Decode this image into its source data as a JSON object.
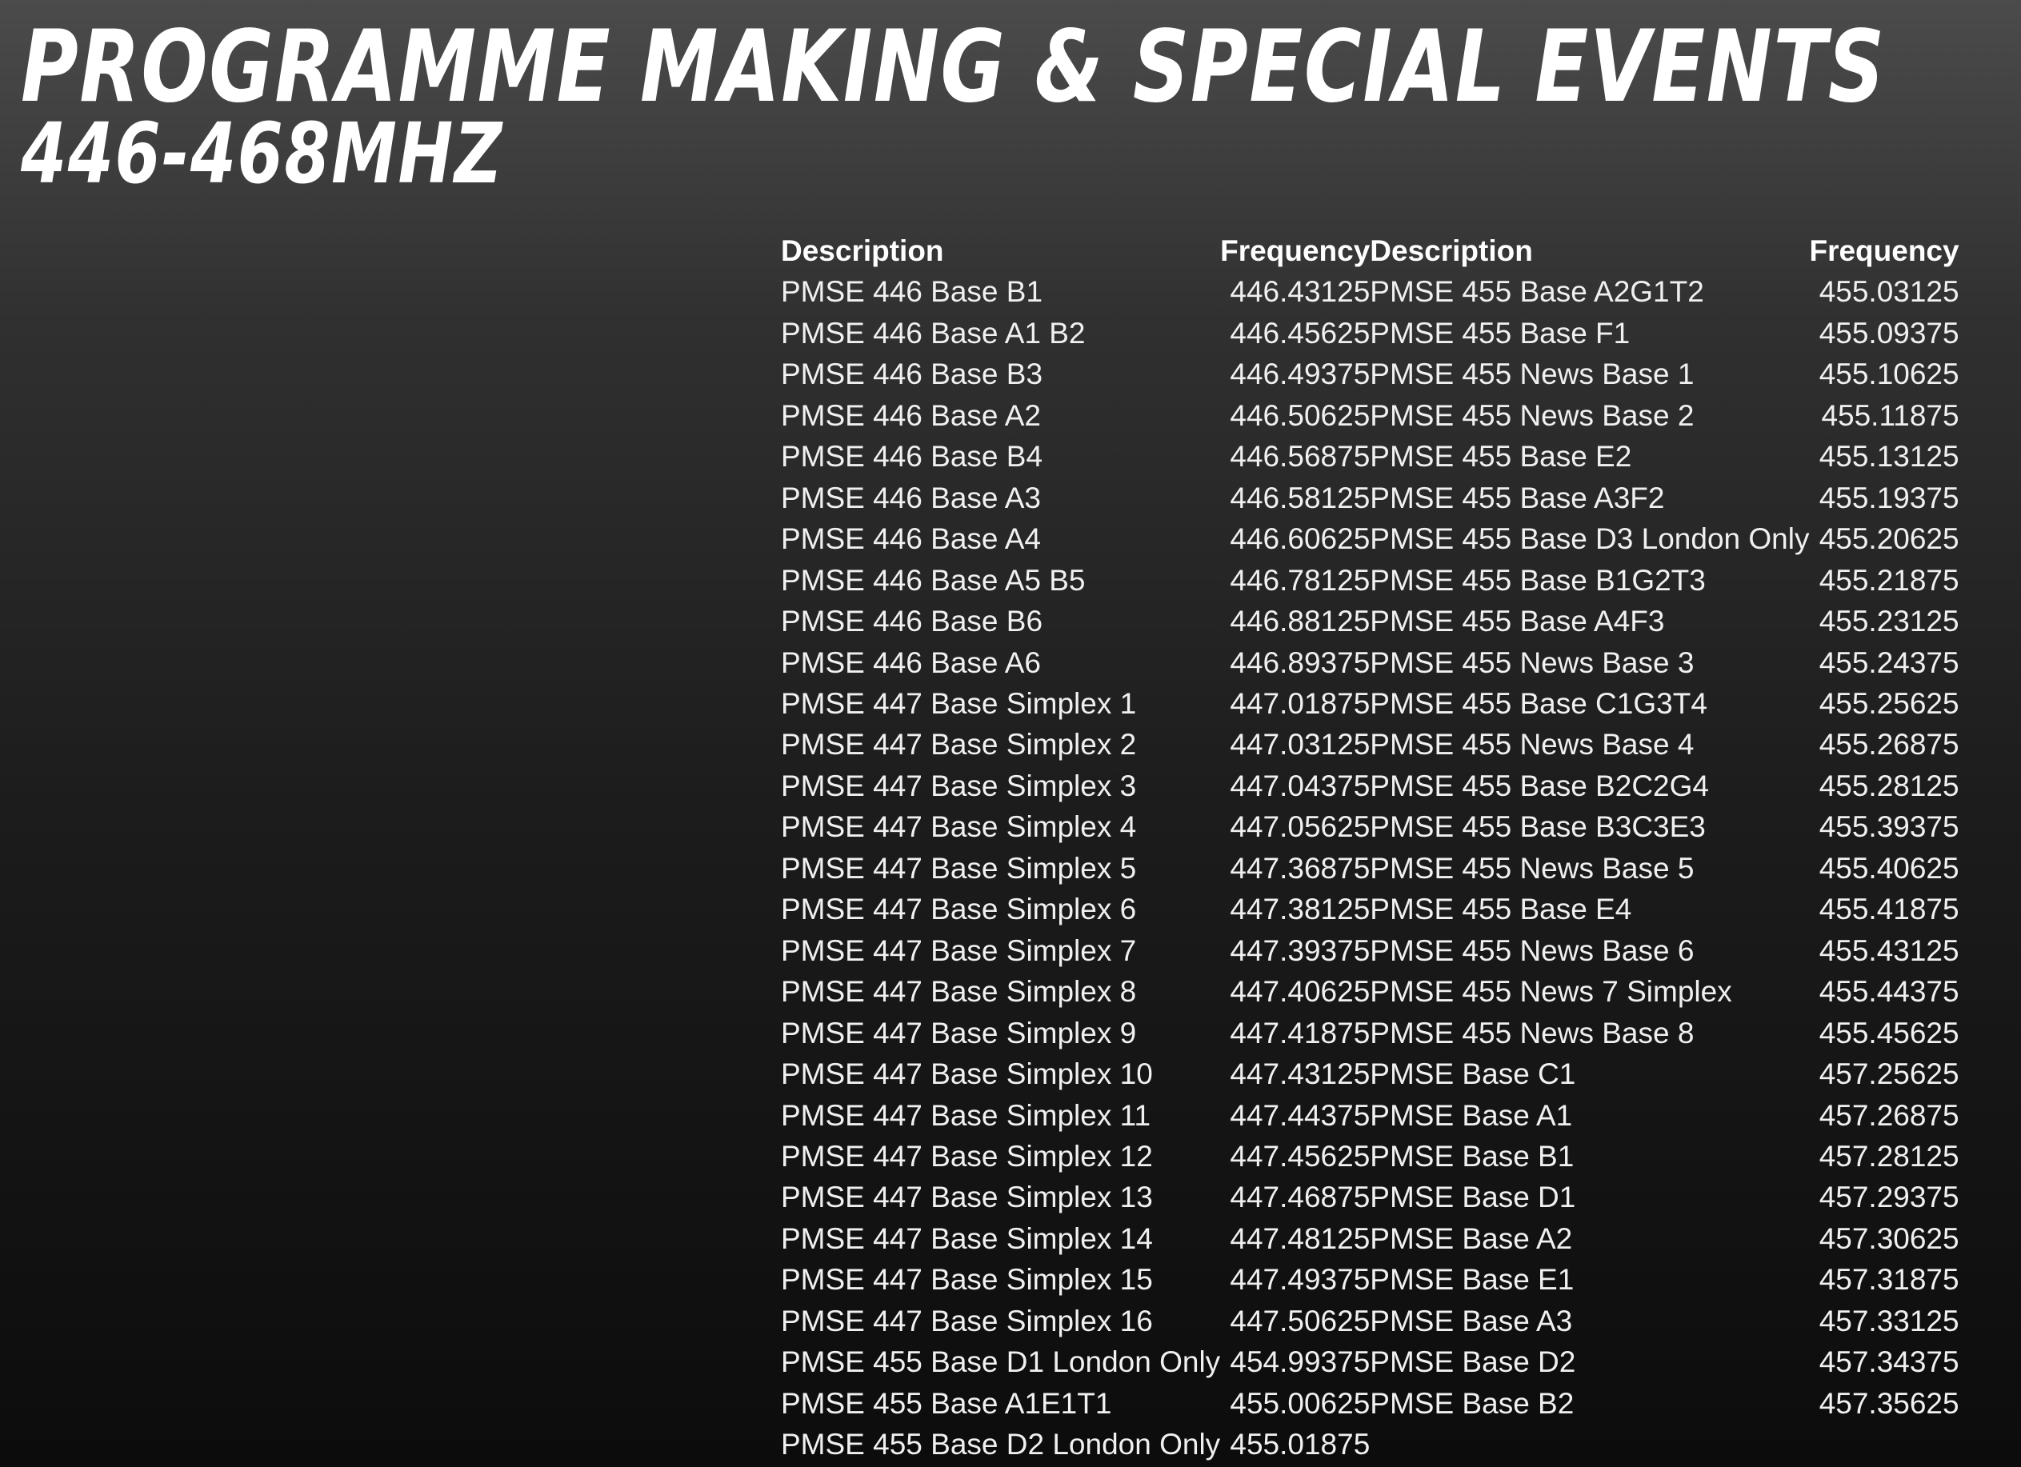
{
  "title": "PROGRAMME MAKING & SPECIAL EVENTS",
  "subtitle": "446-468MHZ",
  "table": {
    "headers": [
      "Description",
      "Frequency",
      "Description",
      "Frequency"
    ],
    "rows": [
      [
        "PMSE 446 Base B1",
        "446.43125",
        "PMSE 455 Base A2G1T2",
        "455.03125"
      ],
      [
        "PMSE 446 Base A1 B2",
        "446.45625",
        "PMSE 455 Base F1",
        "455.09375"
      ],
      [
        "PMSE 446 Base B3",
        "446.49375",
        "PMSE 455 News Base 1",
        "455.10625"
      ],
      [
        "PMSE 446 Base A2",
        "446.50625",
        "PMSE 455 News Base 2",
        "455.11875"
      ],
      [
        "PMSE 446 Base B4",
        "446.56875",
        "PMSE 455 Base E2",
        "455.13125"
      ],
      [
        "PMSE 446 Base A3",
        "446.58125",
        "PMSE 455 Base A3F2",
        "455.19375"
      ],
      [
        "PMSE 446 Base A4",
        "446.60625",
        "PMSE 455 Base D3 London Only",
        "455.20625"
      ],
      [
        "PMSE 446 Base A5 B5",
        "446.78125",
        "PMSE 455 Base B1G2T3",
        "455.21875"
      ],
      [
        "PMSE 446 Base B6",
        "446.88125",
        "PMSE 455 Base A4F3",
        "455.23125"
      ],
      [
        "PMSE 446 Base A6",
        "446.89375",
        "PMSE 455 News Base 3",
        "455.24375"
      ],
      [
        "PMSE 447 Base Simplex 1",
        "447.01875",
        "PMSE 455 Base C1G3T4",
        "455.25625"
      ],
      [
        "PMSE 447 Base Simplex 2",
        "447.03125",
        "PMSE 455 News Base 4",
        "455.26875"
      ],
      [
        "PMSE 447 Base Simplex 3",
        "447.04375",
        "PMSE 455 Base B2C2G4",
        "455.28125"
      ],
      [
        "PMSE 447 Base Simplex 4",
        "447.05625",
        "PMSE 455 Base B3C3E3",
        "455.39375"
      ],
      [
        "PMSE 447 Base Simplex 5",
        "447.36875",
        "PMSE 455 News Base 5",
        "455.40625"
      ],
      [
        "PMSE 447 Base Simplex 6",
        "447.38125",
        "PMSE 455 Base E4",
        "455.41875"
      ],
      [
        "PMSE 447 Base Simplex 7",
        "447.39375",
        "PMSE 455 News Base 6",
        "455.43125"
      ],
      [
        "PMSE 447 Base Simplex 8",
        "447.40625",
        "PMSE 455 News 7 Simplex",
        "455.44375"
      ],
      [
        "PMSE 447 Base Simplex 9",
        "447.41875",
        "PMSE 455 News Base 8",
        "455.45625"
      ],
      [
        "PMSE 447 Base Simplex 10",
        "447.43125",
        "PMSE Base C1",
        "457.25625"
      ],
      [
        "PMSE 447 Base Simplex 11",
        "447.44375",
        "PMSE Base A1",
        "457.26875"
      ],
      [
        "PMSE 447 Base Simplex 12",
        "447.45625",
        "PMSE Base B1",
        "457.28125"
      ],
      [
        "PMSE 447 Base Simplex 13",
        "447.46875",
        "PMSE Base D1",
        "457.29375"
      ],
      [
        "PMSE 447 Base Simplex 14",
        "447.48125",
        "PMSE Base A2",
        "457.30625"
      ],
      [
        "PMSE 447 Base Simplex 15",
        "447.49375",
        "PMSE Base E1",
        "457.31875"
      ],
      [
        "PMSE 447 Base Simplex 16",
        "447.50625",
        "PMSE Base A3",
        "457.33125"
      ],
      [
        "PMSE 455 Base D1 London Only",
        "454.99375",
        "PMSE Base D2",
        "457.34375"
      ],
      [
        "PMSE 455 Base A1E1T1",
        "455.00625",
        "PMSE Base B2",
        "457.35625"
      ],
      [
        "PMSE 455 Base D2 London Only",
        "455.01875",
        "",
        ""
      ]
    ]
  }
}
